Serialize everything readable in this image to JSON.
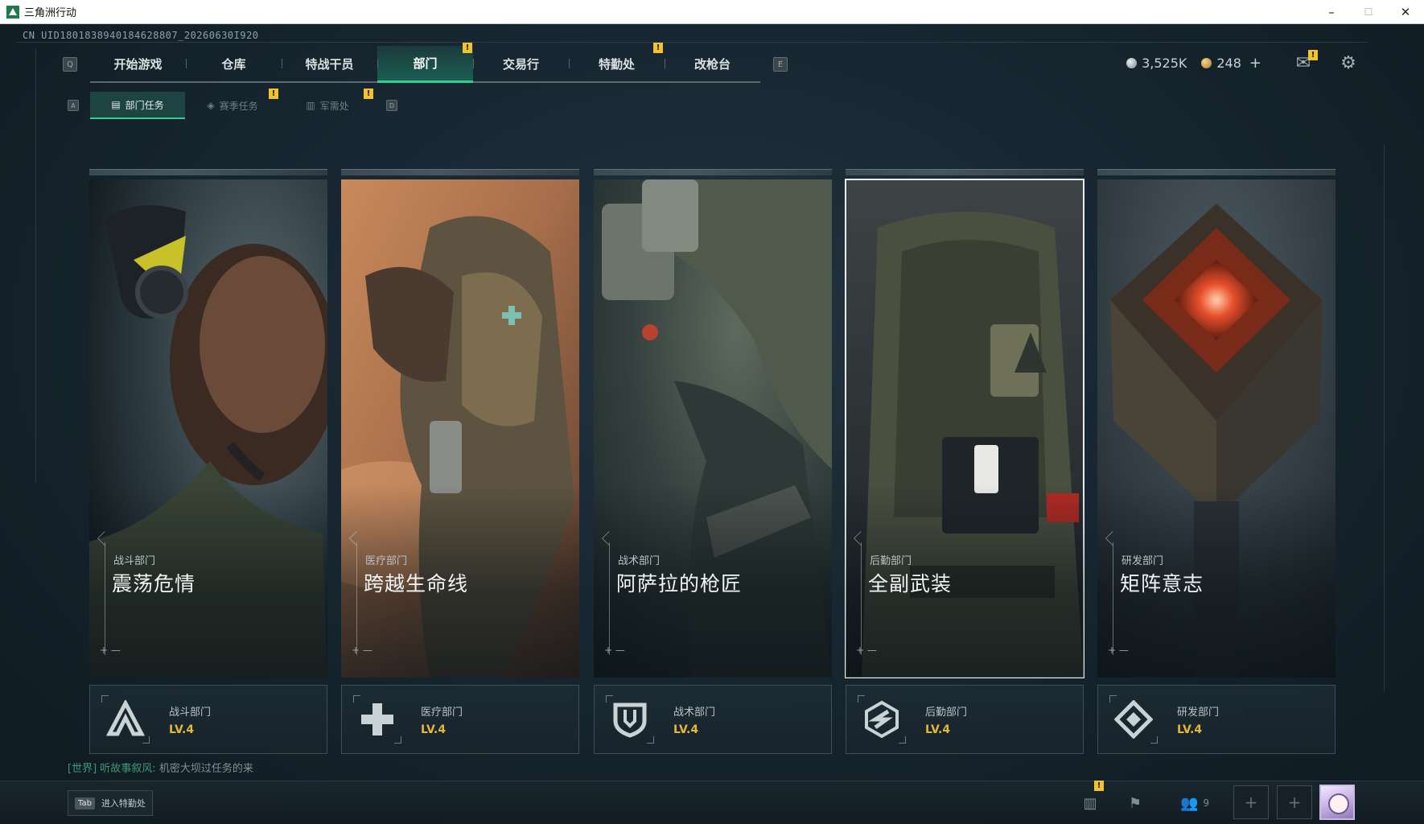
{
  "window": {
    "title": "三角洲行动",
    "min": "–",
    "max": "☐",
    "close": "✕"
  },
  "uid": "CN UID1801838940184628807_20260630I920",
  "nav": {
    "left_key": "Q",
    "right_key": "E",
    "tabs": [
      {
        "label": "开始游戏",
        "active": false,
        "badge": ""
      },
      {
        "label": "仓库",
        "active": false,
        "badge": ""
      },
      {
        "label": "特战干员",
        "active": false,
        "badge": ""
      },
      {
        "label": "部门",
        "active": true,
        "badge": "!"
      },
      {
        "label": "交易行",
        "active": false,
        "badge": ""
      },
      {
        "label": "特勤处",
        "active": false,
        "badge": "!"
      },
      {
        "label": "改枪台",
        "active": false,
        "badge": ""
      }
    ]
  },
  "subnav": {
    "left_key": "A",
    "right_key": "D",
    "tabs": [
      {
        "label": "部门任务",
        "active": true,
        "badge": ""
      },
      {
        "label": "赛季任务",
        "active": false,
        "badge": "!"
      },
      {
        "label": "军需处",
        "active": false,
        "badge": "!"
      }
    ]
  },
  "currency": {
    "silver": "3,525K",
    "gold": "248",
    "add": "+"
  },
  "header_icons": {
    "mail_badge": "!"
  },
  "cards": [
    {
      "category": "战斗部门",
      "name": "震荡危情",
      "level": "LV.4",
      "selected": false,
      "emblem": "combat-emblem-icon"
    },
    {
      "category": "医疗部门",
      "name": "跨越生命线",
      "level": "LV.4",
      "selected": false,
      "emblem": "medical-emblem-icon"
    },
    {
      "category": "战术部门",
      "name": "阿萨拉的枪匠",
      "level": "LV.4",
      "selected": false,
      "emblem": "tactical-emblem-icon"
    },
    {
      "category": "后勤部门",
      "name": "全副武装",
      "level": "LV.4",
      "selected": true,
      "emblem": "logistics-emblem-icon"
    },
    {
      "category": "研发部门",
      "name": "矩阵意志",
      "level": "LV.4",
      "selected": false,
      "emblem": "research-emblem-icon"
    }
  ],
  "chat": {
    "channel": "[世界]",
    "sender": "听故事叙风:",
    "message": "机密大坝过任务的来"
  },
  "bottom": {
    "tab_key": "Tab",
    "tab_label": "进入特勤处",
    "friends_count": "9",
    "stats_badge": "!"
  },
  "colors": {
    "accent": "#2ed18f",
    "badge": "#f2c230",
    "level": "#e5b832"
  }
}
